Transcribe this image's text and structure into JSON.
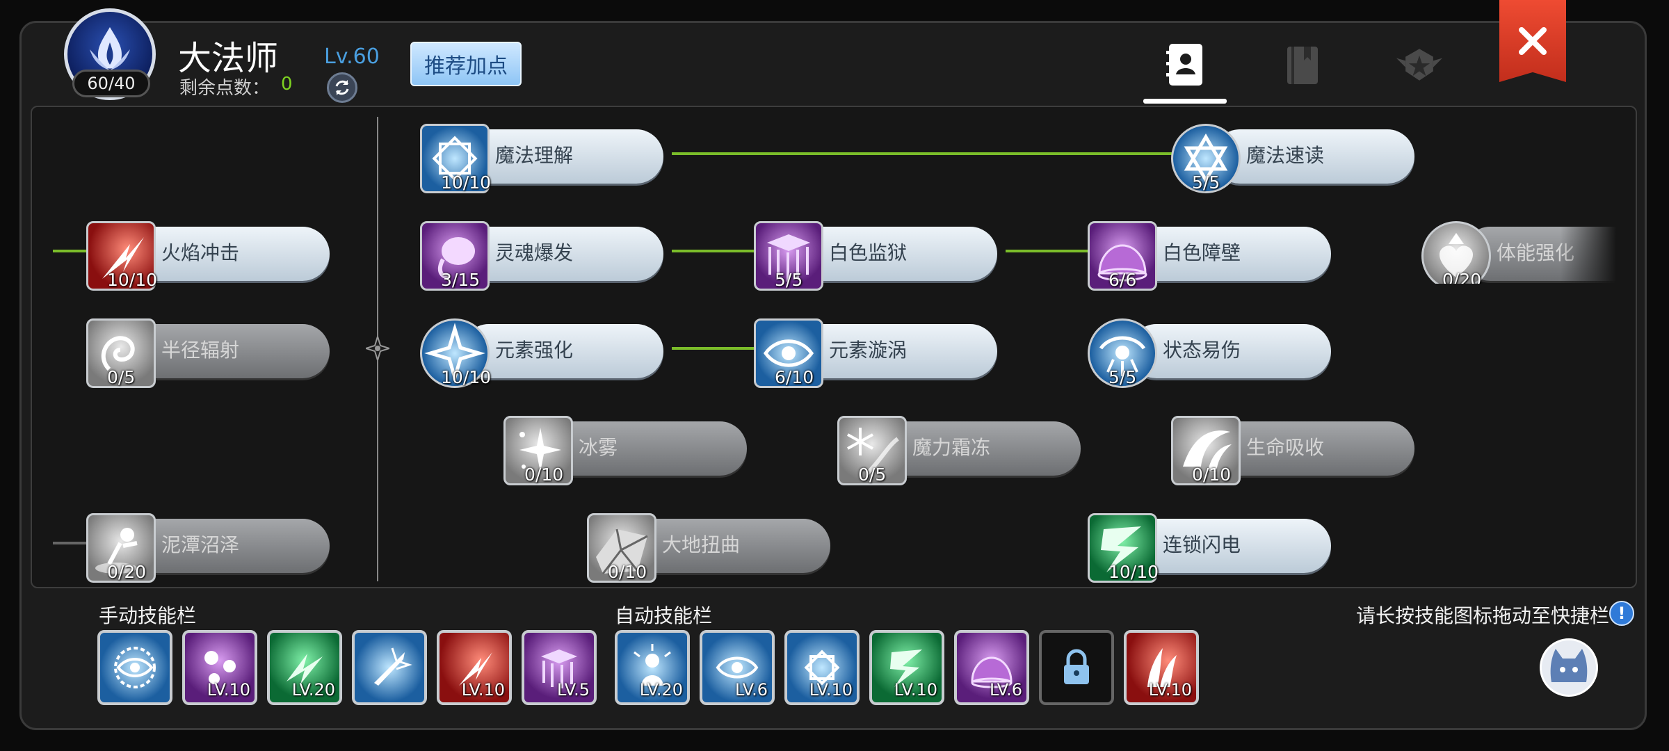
{
  "header": {
    "class_name": "大法师",
    "exp_text": "60/40",
    "level_text": "Lv.60",
    "points_label": "剩余点数：",
    "points_value": "0",
    "recommend_label": "推荐加点"
  },
  "tabs": [
    {
      "name": "character-tab",
      "icon": "contact-book-icon",
      "active": true
    },
    {
      "name": "book-tab",
      "icon": "bookmark-book-icon",
      "active": false
    },
    {
      "name": "emblem-tab",
      "icon": "winged-star-emblem-icon",
      "active": false
    }
  ],
  "skills": [
    {
      "id": "magic-understanding",
      "name": "魔法理解",
      "level": "10/10",
      "locked": false,
      "color": "blue",
      "icon": "octagram-icon"
    },
    {
      "id": "fast-cast",
      "name": "魔法速读",
      "level": "5/5",
      "locked": false,
      "color": "blue",
      "icon": "hexagram-icon"
    },
    {
      "id": "flame-strike",
      "name": "火焰冲击",
      "level": "10/10",
      "locked": false,
      "color": "red",
      "icon": "flame-burst-icon"
    },
    {
      "id": "soul-burst",
      "name": "灵魂爆发",
      "level": "3/15",
      "locked": false,
      "color": "purple",
      "icon": "soul-orb-icon"
    },
    {
      "id": "white-prison",
      "name": "白色监狱",
      "level": "5/5",
      "locked": false,
      "color": "purple",
      "icon": "cage-icon"
    },
    {
      "id": "white-barrier",
      "name": "白色障壁",
      "level": "6/6",
      "locked": false,
      "color": "purple",
      "icon": "dome-icon"
    },
    {
      "id": "body-strengthen",
      "name": "体能强化",
      "level": "0/20",
      "locked": true,
      "color": "grey",
      "icon": "heart-arrow-icon"
    },
    {
      "id": "radius-radiation",
      "name": "半径辐射",
      "level": "0/5",
      "locked": true,
      "color": "grey",
      "icon": "swirl-icon"
    },
    {
      "id": "element-enhance",
      "name": "元素强化",
      "level": "10/10",
      "locked": false,
      "color": "blue",
      "icon": "four-point-star-icon"
    },
    {
      "id": "element-vortex",
      "name": "元素漩涡",
      "level": "6/10",
      "locked": false,
      "color": "blue",
      "icon": "vortex-eye-icon"
    },
    {
      "id": "status-vulnerable",
      "name": "状态易伤",
      "level": "5/5",
      "locked": false,
      "color": "blue",
      "icon": "eye-rune-icon"
    },
    {
      "id": "ice-fog",
      "name": "冰雾",
      "level": "0/10",
      "locked": true,
      "color": "grey",
      "icon": "sparkle-icon"
    },
    {
      "id": "mana-frost",
      "name": "魔力霜冻",
      "level": "0/5",
      "locked": true,
      "color": "grey",
      "icon": "snowflake-icon"
    },
    {
      "id": "life-drain",
      "name": "生命吸收",
      "level": "0/10",
      "locked": true,
      "color": "grey",
      "icon": "claw-wave-icon"
    },
    {
      "id": "mud-swamp",
      "name": "泥潭沼泽",
      "level": "0/20",
      "locked": true,
      "color": "grey",
      "icon": "sinking-figure-icon"
    },
    {
      "id": "earth-twist",
      "name": "大地扭曲",
      "level": "0/10",
      "locked": true,
      "color": "grey",
      "icon": "cracked-ground-icon"
    },
    {
      "id": "chain-lightning",
      "name": "连锁闪电",
      "level": "10/10",
      "locked": false,
      "color": "green",
      "icon": "lightning-icon"
    }
  ],
  "manual_bar": {
    "title": "手动技能栏",
    "slots": [
      {
        "icon": "eye-sun-icon",
        "level": "",
        "color": "blue"
      },
      {
        "icon": "triple-sun-icon",
        "level": "LV.10",
        "color": "purple"
      },
      {
        "icon": "green-burst-icon",
        "level": "LV.20",
        "color": "green"
      },
      {
        "icon": "sword-strike-icon",
        "level": "",
        "color": "blue"
      },
      {
        "icon": "flame-burst-icon",
        "level": "LV.10",
        "color": "red"
      },
      {
        "icon": "cage-icon",
        "level": "LV.5",
        "color": "purple"
      }
    ]
  },
  "auto_bar": {
    "title": "自动技能栏",
    "slots": [
      {
        "icon": "radiant-figure-icon",
        "level": "LV.20",
        "color": "blue"
      },
      {
        "icon": "vortex-eye-icon",
        "level": "LV.6",
        "color": "blue"
      },
      {
        "icon": "octagram-icon",
        "level": "LV.10",
        "color": "blue"
      },
      {
        "icon": "lightning-icon",
        "level": "LV.10",
        "color": "green"
      },
      {
        "icon": "dome-icon",
        "level": "LV.6",
        "color": "purple"
      },
      {
        "icon": "lock-icon",
        "level": "",
        "color": "locked"
      },
      {
        "icon": "fire-claw-icon",
        "level": "LV.10",
        "color": "red"
      }
    ]
  },
  "hint": "请长按技能图标拖动至快捷栏",
  "hint_icon_text": "!",
  "colors": {
    "accent_green": "#7bbd2a",
    "level_blue": "#4a9fe0",
    "close_red": "#d83a24"
  }
}
